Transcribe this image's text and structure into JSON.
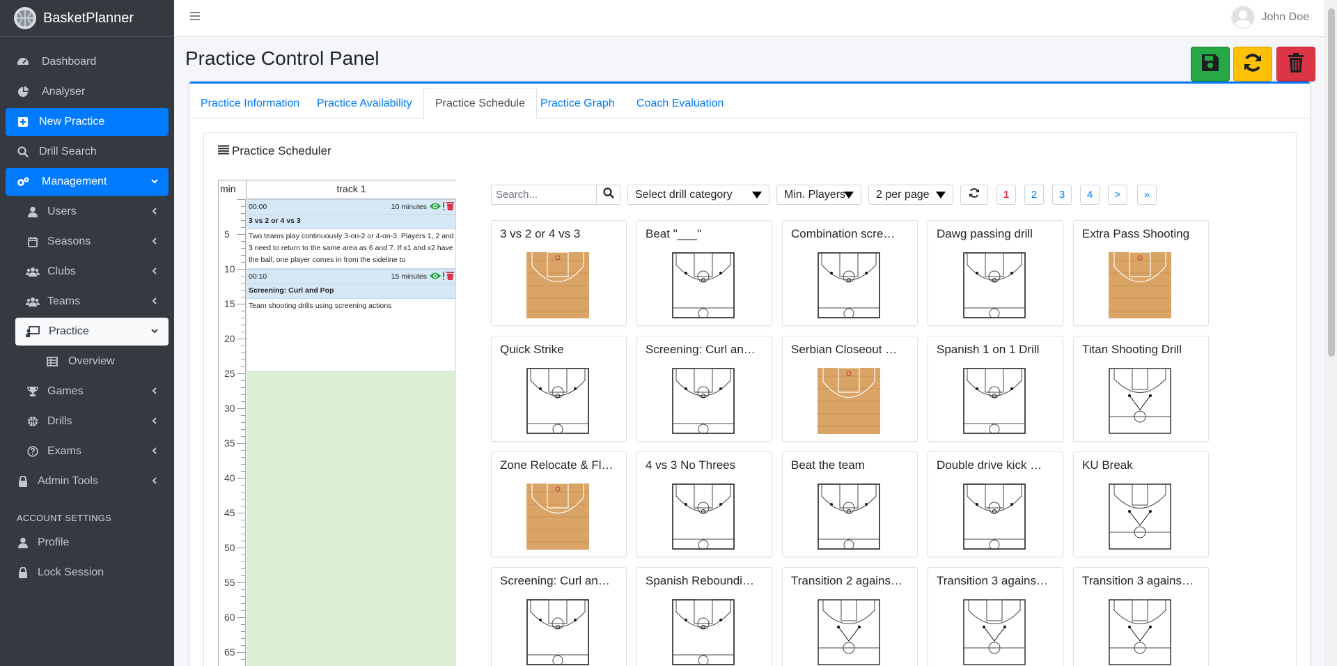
{
  "brand": {
    "name": "BasketPlanner"
  },
  "sidebar": {
    "items": [
      {
        "label": "Dashboard",
        "icon": "dashboard-icon"
      },
      {
        "label": "Analyser",
        "icon": "pie-chart-icon"
      },
      {
        "label": "New Practice",
        "icon": "plus-square-icon",
        "active": true
      },
      {
        "label": "Drill Search",
        "icon": "search-icon"
      },
      {
        "label": "Management",
        "icon": "gears-icon",
        "active": true
      },
      {
        "label": "Users",
        "icon": "user-icon"
      },
      {
        "label": "Seasons",
        "icon": "calendar-icon"
      },
      {
        "label": "Clubs",
        "icon": "users-icon"
      },
      {
        "label": "Teams",
        "icon": "users-icon"
      },
      {
        "label": "Practice",
        "icon": "chalkboard-teacher-icon"
      },
      {
        "label": "Overview",
        "icon": "table-icon"
      },
      {
        "label": "Games",
        "icon": "trophy-icon"
      },
      {
        "label": "Drills",
        "icon": "basketball-icon"
      },
      {
        "label": "Exams",
        "icon": "question-circle-icon"
      },
      {
        "label": "Admin Tools",
        "icon": "lock-icon"
      }
    ],
    "account_header": "ACCOUNT SETTINGS",
    "account_items": [
      {
        "label": "Profile",
        "icon": "user-icon"
      },
      {
        "label": "Lock Session",
        "icon": "lock-icon"
      }
    ]
  },
  "topbar": {
    "user_name": "John Doe"
  },
  "page": {
    "title": "Practice Control Panel"
  },
  "colors": {
    "primary": "#007bff",
    "success": "#28a745",
    "warning": "#ffc107",
    "danger": "#dc3545",
    "sidebar": "#343a40",
    "track_bg": "#dcefd5"
  },
  "tabs": [
    "Practice Information",
    "Practice Availability",
    "Practice Schedule",
    "Practice Graph",
    "Coach Evaluation"
  ],
  "active_tab": "Practice Schedule",
  "scheduler": {
    "title": "Practice Scheduler",
    "col_min": "min",
    "col_track": "track 1",
    "ruler_labels": [
      "5",
      "10",
      "15",
      "20",
      "25",
      "30",
      "35",
      "40",
      "45",
      "50",
      "55",
      "60",
      "65"
    ],
    "blocks": [
      {
        "start": "00:00",
        "duration": "10 minutes",
        "name": "3 vs 2 or 4 vs 3",
        "description": "Two teams play continuously 3-on-2 or 4-on-3. Players 1, 2 and 3 need to return to the same area as 6 and 7. If x1 and x2 have the ball, one player comes in from the sideline to"
      },
      {
        "start": "00:10",
        "duration": "15 minutes",
        "name": "Screening: Curl and Pop",
        "description": "Team shooting drills using screening actions"
      }
    ]
  },
  "filters": {
    "search_placeholder": "Search...",
    "category_label": "Select drill category",
    "players_label": "Min. Players",
    "per_page_label": "2 per page",
    "pages": [
      "1",
      "2",
      "3",
      "4",
      ">",
      "»"
    ],
    "current_page": "1"
  },
  "drills": [
    {
      "title": "3 vs 2 or 4 vs 3",
      "thumb": "wood"
    },
    {
      "title": "Beat \"___\"",
      "thumb": "half"
    },
    {
      "title": "Combination scre…",
      "thumb": "half"
    },
    {
      "title": "Dawg passing drill",
      "thumb": "half"
    },
    {
      "title": "Extra Pass Shooting",
      "thumb": "wood"
    },
    {
      "title": "Quick Strike",
      "thumb": "half"
    },
    {
      "title": "Screening: Curl an…",
      "thumb": "half"
    },
    {
      "title": "Serbian Closeout …",
      "thumb": "wood"
    },
    {
      "title": "Spanish 1 on 1 Drill",
      "thumb": "half"
    },
    {
      "title": "Titan Shooting Drill",
      "thumb": "full"
    },
    {
      "title": "Zone Relocate & Fl…",
      "thumb": "wood"
    },
    {
      "title": "4 vs 3 No Threes",
      "thumb": "half"
    },
    {
      "title": "Beat the team",
      "thumb": "half"
    },
    {
      "title": "Double drive kick …",
      "thumb": "half"
    },
    {
      "title": "KU Break",
      "thumb": "full"
    },
    {
      "title": "Screening: Curl an…",
      "thumb": "half"
    },
    {
      "title": "Spanish Reboundi…",
      "thumb": "half"
    },
    {
      "title": "Transition 2 agains…",
      "thumb": "full"
    },
    {
      "title": "Transition 3 agains…",
      "thumb": "full"
    },
    {
      "title": "Transition 3 agains…",
      "thumb": "full"
    }
  ]
}
